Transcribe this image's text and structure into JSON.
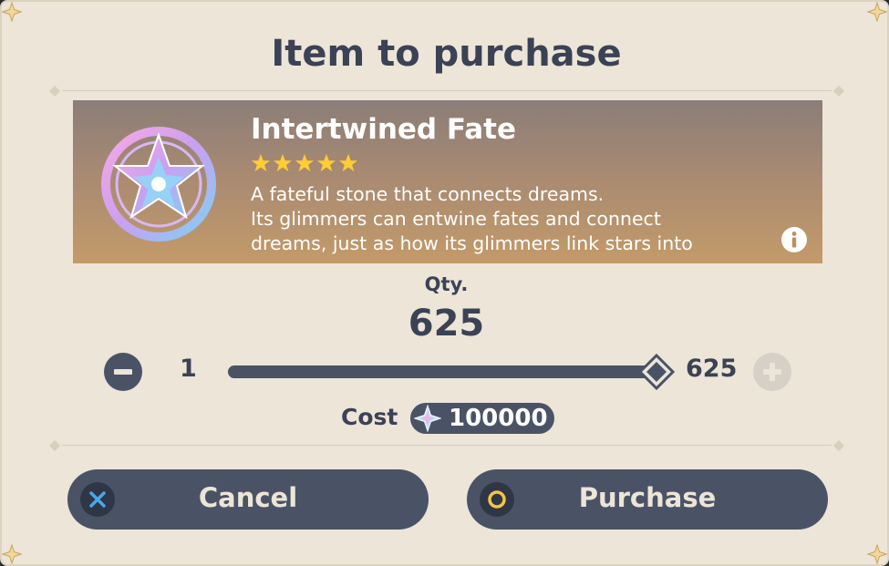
{
  "dialog": {
    "title": "Item to purchase",
    "item": {
      "name": "Intertwined Fate",
      "rarity_stars": 5,
      "description_lines": [
        "A fateful stone that connects dreams.",
        "Its glimmers can entwine fates and connect",
        "dreams, just as how its glimmers link stars into"
      ],
      "icon": "intertwined-fate-icon",
      "info_icon": "info-icon"
    },
    "quantity": {
      "label": "Qty.",
      "value": "625",
      "min_label": "1",
      "max_label": "625",
      "min": 1,
      "max": 625,
      "current": 625
    },
    "cost": {
      "label": "Cost",
      "currency_icon": "primogem-icon",
      "value": "100000"
    },
    "buttons": {
      "cancel_label": "Cancel",
      "purchase_label": "Purchase"
    },
    "colors": {
      "panel": "#ece5d8",
      "text_dark": "#3b4255",
      "button_bg": "#4a5366",
      "star_gold": "#ffcc33",
      "cancel_icon": "#4aa8e8",
      "purchase_icon": "#f5c542"
    }
  }
}
